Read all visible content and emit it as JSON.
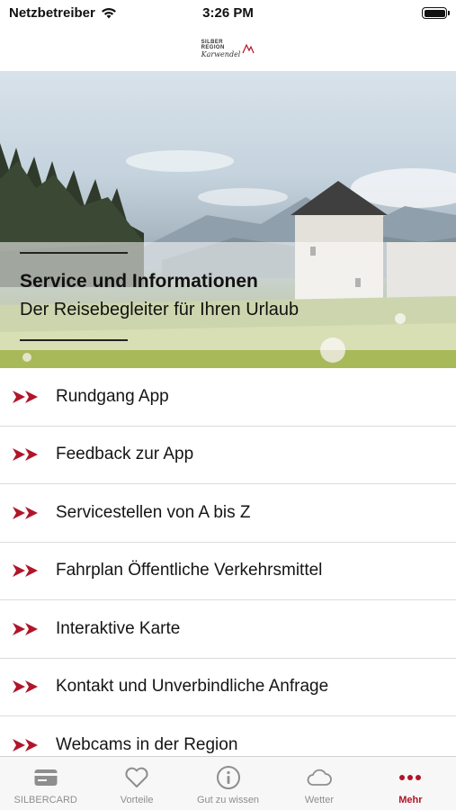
{
  "status_bar": {
    "carrier": "Netzbetreiber",
    "time": "3:26 PM"
  },
  "header": {
    "logo_line1": "SILBER",
    "logo_line2": "REGION",
    "logo_script": "Karwendel"
  },
  "hero": {
    "title": "Service und Informationen",
    "subtitle": "Der Reisebegleiter für Ihren Urlaub"
  },
  "menu": {
    "items": [
      {
        "label": "Rundgang App"
      },
      {
        "label": "Feedback zur App"
      },
      {
        "label": "Servicestellen von A bis Z"
      },
      {
        "label": "Fahrplan Öffentliche Verkehrsmittel"
      },
      {
        "label": "Interaktive Karte"
      },
      {
        "label": "Kontakt und Unverbindliche Anfrage"
      },
      {
        "label": "Webcams in der Region"
      }
    ]
  },
  "tabs": [
    {
      "label": "SILBERCARD",
      "icon": "card-icon"
    },
    {
      "label": "Vorteile",
      "icon": "heart-icon"
    },
    {
      "label": "Gut zu wissen",
      "icon": "info-icon"
    },
    {
      "label": "Wetter",
      "icon": "cloud-icon"
    },
    {
      "label": "Mehr",
      "icon": "more-icon",
      "active": true
    }
  ],
  "colors": {
    "accent": "#b0152a",
    "tab_inactive": "#8e8e8e"
  }
}
